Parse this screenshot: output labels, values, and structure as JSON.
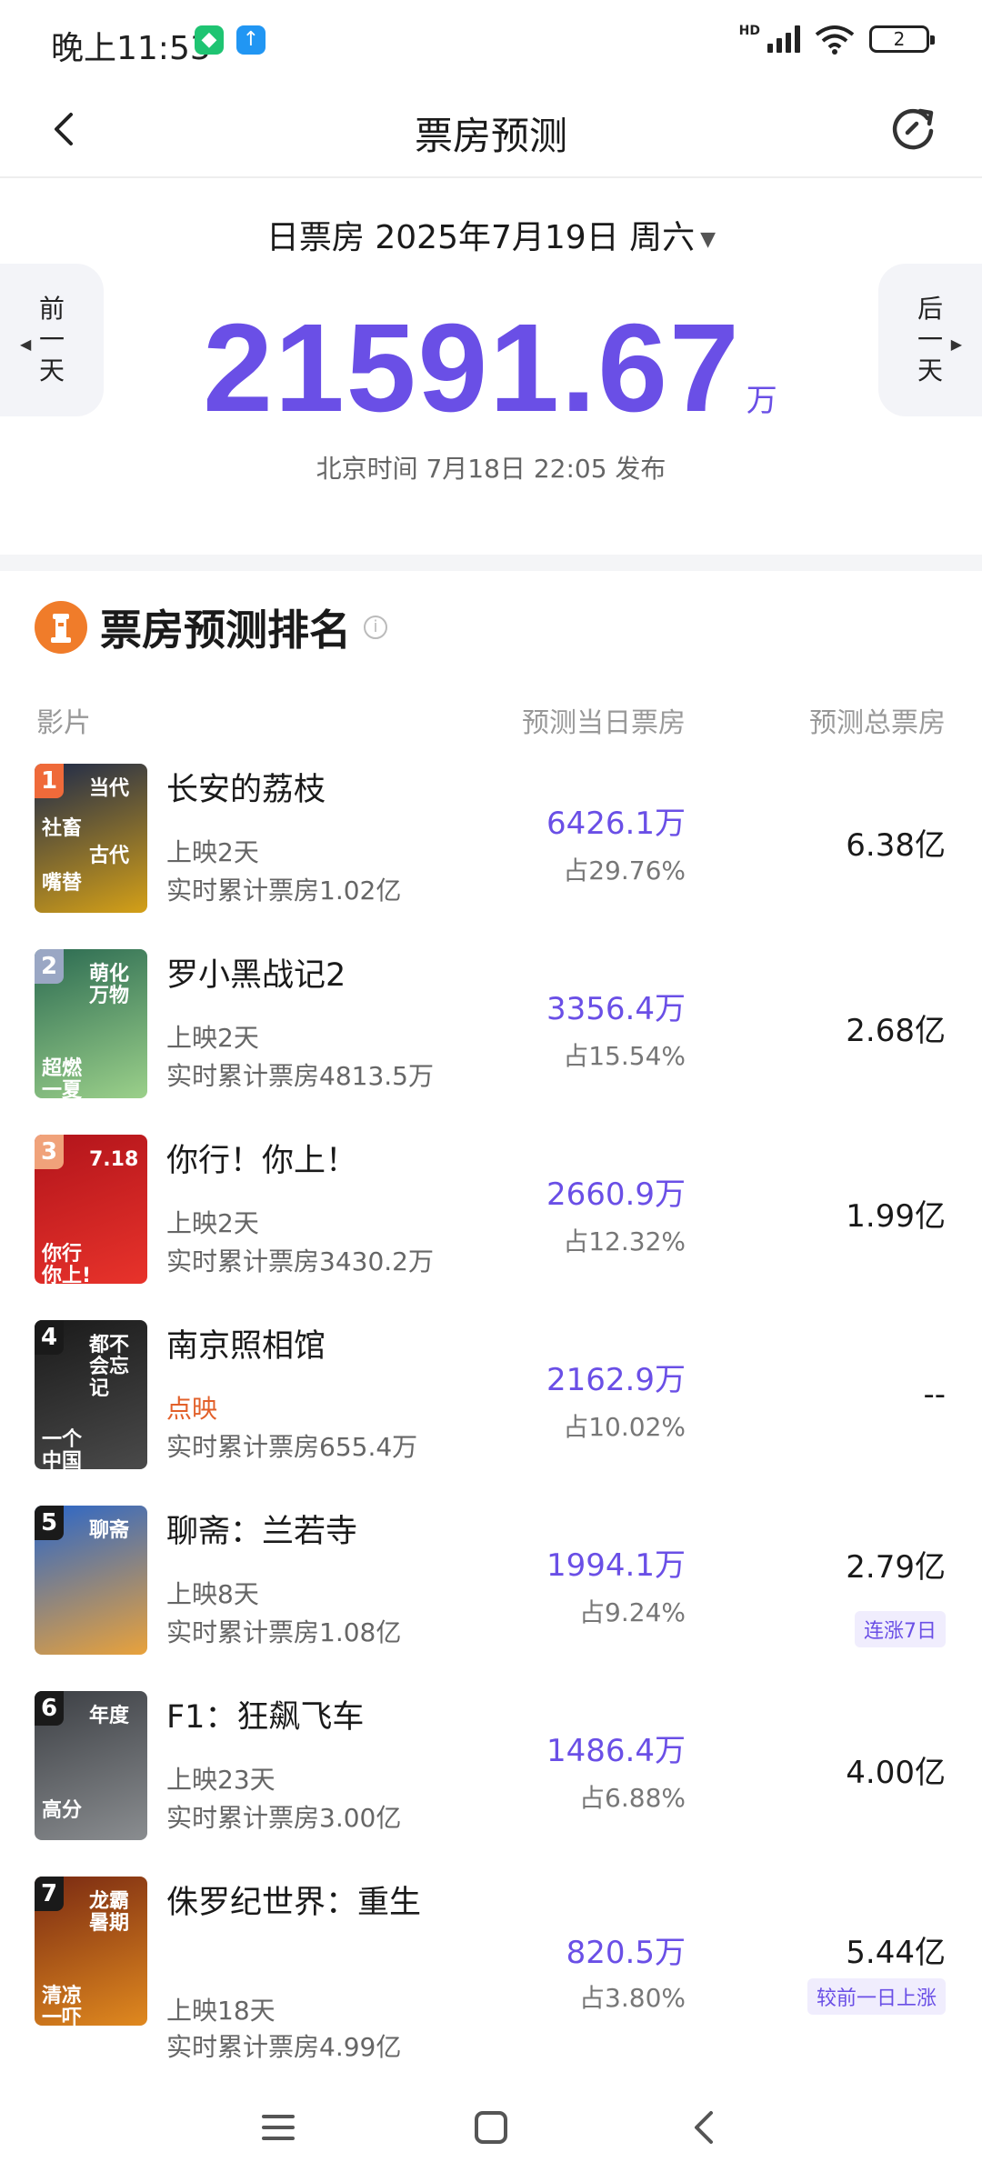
{
  "status_bar": {
    "time": "晚上11:53",
    "hd_label": "HD",
    "battery": "2",
    "app_icon_colors": [
      "#1fc472",
      "#2196f3"
    ]
  },
  "nav": {
    "title": "票房预测",
    "back_icon": "chevron-left-icon",
    "refresh_icon": "refresh-icon"
  },
  "summary": {
    "date_text": "日票房 2025年7月19日 周六",
    "prev_day": [
      "前",
      "一",
      "天"
    ],
    "next_day": [
      "后",
      "一",
      "天"
    ],
    "total_value": "21591.67",
    "total_unit": "万",
    "publish_time": "北京时间 7月18日 22:05 发布"
  },
  "ranking": {
    "title": "票房预测排名",
    "col_film": "影片",
    "col_day": "预测当日票房",
    "col_total": "预测总票房"
  },
  "films": [
    {
      "rank": "1",
      "name": "长安的荔枝",
      "days": "上映2天",
      "cum": "实时累计票房1.02亿",
      "day_box": "6426.1万",
      "share": "占29.76%",
      "total": "6.38亿",
      "tag": "",
      "poster_colors": [
        "#1e2a4a",
        "#d4a017"
      ],
      "badge_color": "#ef6a3a",
      "poster_text": [
        "当代",
        "嘴替",
        "古代",
        "社畜"
      ]
    },
    {
      "rank": "2",
      "name": "罗小黑战记2",
      "days": "上映2天",
      "cum": "实时累计票房4813.5万",
      "day_box": "3356.4万",
      "share": "占15.54%",
      "total": "2.68亿",
      "tag": "",
      "poster_colors": [
        "#2c6b52",
        "#9bd08a"
      ],
      "badge_color": "#9aa7c4",
      "poster_text": [
        "萌化万物",
        "超燃一夏"
      ]
    },
    {
      "rank": "3",
      "name": "你行！你上！",
      "days": "上映2天",
      "cum": "实时累计票房3430.2万",
      "day_box": "2660.9万",
      "share": "占12.32%",
      "total": "1.99亿",
      "tag": "",
      "poster_colors": [
        "#b2141b",
        "#e8332b"
      ],
      "badge_color": "#f0a27a",
      "poster_text": [
        "7.18",
        "你行你上!"
      ]
    },
    {
      "rank": "4",
      "name": "南京照相馆",
      "days": "点映",
      "days_preview": true,
      "cum": "实时累计票房655.4万",
      "day_box": "2162.9万",
      "share": "占10.02%",
      "total": "--",
      "tag": "",
      "poster_colors": [
        "#1a1a1a",
        "#4a4a4a"
      ],
      "badge_color": "#1a1a1a",
      "poster_text": [
        "都不会忘记",
        "一个中国人"
      ]
    },
    {
      "rank": "5",
      "name": "聊斋：兰若寺",
      "days": "上映8天",
      "cum": "实时累计票房1.08亿",
      "day_box": "1994.1万",
      "share": "占9.24%",
      "total": "2.79亿",
      "tag": "连涨7日",
      "poster_colors": [
        "#2a66c9",
        "#e9a23b"
      ],
      "badge_color": "#1a1a1a",
      "poster_text": [
        "聊斋"
      ]
    },
    {
      "rank": "6",
      "name": "F1：狂飙飞车",
      "days": "上映23天",
      "cum": "实时累计票房3.00亿",
      "day_box": "1486.4万",
      "share": "占6.88%",
      "total": "4.00亿",
      "tag": "",
      "poster_colors": [
        "#3c3f44",
        "#8a8d90"
      ],
      "badge_color": "#1a1a1a",
      "poster_text": [
        "年度",
        "高分"
      ]
    },
    {
      "rank": "7",
      "name": "侏罗纪世界：重生",
      "days": "上映18天",
      "cum": "实时累计票房4.99亿",
      "day_box": "820.5万",
      "share": "占3.80%",
      "total": "5.44亿",
      "tag": "较前一日上涨",
      "poster_colors": [
        "#7a2a12",
        "#e0891f"
      ],
      "badge_color": "#1a1a1a",
      "poster_text": [
        "龙霸暑期",
        "清凉一吓"
      ]
    }
  ],
  "bottom_nav": {
    "items": [
      "menu-icon",
      "home-icon",
      "back-icon"
    ]
  },
  "colors": {
    "accent": "#6a4fe6",
    "tag_bg": "#f0edfd",
    "preview": "#e2602a",
    "logo": "#f07c2a"
  }
}
